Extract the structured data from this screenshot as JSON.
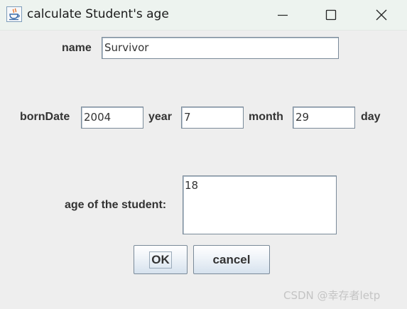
{
  "window": {
    "title": "calculate Student's age",
    "icon": "java-coffee-cup-icon"
  },
  "title_controls": {
    "minimize_icon": "minimize-icon",
    "maximize_icon": "maximize-icon",
    "close_icon": "close-icon"
  },
  "form": {
    "name_label": "name",
    "name_value": "Survivor",
    "born_label": "bornDate",
    "year_value": "2004",
    "year_label": "year",
    "month_value": "7",
    "month_label": "month",
    "day_value": "29",
    "day_label": "day",
    "age_label": "age of the student:",
    "age_value": "18"
  },
  "buttons": {
    "ok_label": "OK",
    "cancel_label": "cancel"
  },
  "watermark": "CSDN @幸存者letp",
  "colors": {
    "titlebar_bg": "#edf3ef",
    "window_bg": "#eeeeee",
    "field_border": "#7a8a99",
    "button_gradient_bottom": "#d6e2ee"
  }
}
